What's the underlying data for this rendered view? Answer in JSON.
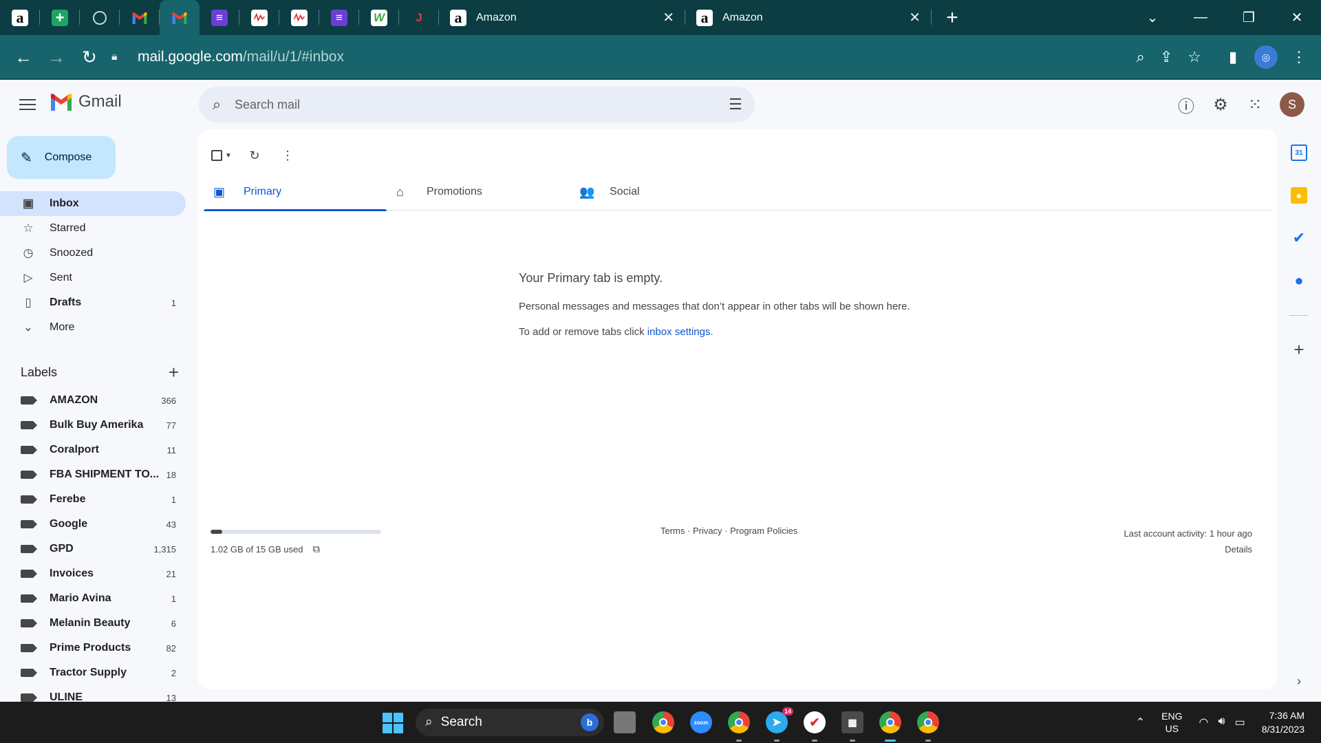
{
  "browser": {
    "pinned_tabs": [
      {
        "icon": "amazon-icon",
        "glyph": "a"
      },
      {
        "icon": "google-sheets-icon",
        "glyph": "+"
      },
      {
        "icon": "globe-icon",
        "glyph": ""
      },
      {
        "icon": "gmail-icon",
        "glyph": "M"
      },
      {
        "icon": "gmail-icon",
        "glyph": "M"
      },
      {
        "icon": "list-app-icon",
        "glyph": "≡"
      },
      {
        "icon": "chart-doc-icon",
        "glyph": "∿"
      },
      {
        "icon": "chart-doc-icon",
        "glyph": "∿"
      },
      {
        "icon": "list-app-icon",
        "glyph": "≡"
      },
      {
        "icon": "green-app-icon",
        "glyph": "W"
      },
      {
        "icon": "dark-app-icon",
        "glyph": "J"
      }
    ],
    "tabs": [
      {
        "title": "Amazon"
      },
      {
        "title": "Amazon"
      }
    ],
    "url": {
      "host": "mail.google.com",
      "path": "/mail/u/1/#inbox"
    }
  },
  "gmail": {
    "product_name": "Gmail",
    "search_placeholder": "Search mail",
    "account_initial": "S",
    "compose_label": "Compose",
    "nav": [
      {
        "label": "Inbox",
        "count": "",
        "icon": "inbox-icon",
        "glyph": "▣"
      },
      {
        "label": "Starred",
        "count": "",
        "icon": "star-icon",
        "glyph": "☆"
      },
      {
        "label": "Snoozed",
        "count": "",
        "icon": "clock-icon",
        "glyph": "◷"
      },
      {
        "label": "Sent",
        "count": "",
        "icon": "send-icon",
        "glyph": "▷"
      },
      {
        "label": "Drafts",
        "count": "1",
        "icon": "draft-icon",
        "glyph": "▯"
      },
      {
        "label": "More",
        "count": "",
        "icon": "chevron-down-icon",
        "glyph": "⌄"
      }
    ],
    "labels_title": "Labels",
    "labels": [
      {
        "name": "AMAZON",
        "count": "366"
      },
      {
        "name": "Bulk Buy Amerika",
        "count": "77"
      },
      {
        "name": "Coralport",
        "count": "11"
      },
      {
        "name": "FBA SHIPMENT TO...",
        "count": "18"
      },
      {
        "name": "Ferebe",
        "count": "1"
      },
      {
        "name": "Google",
        "count": "43"
      },
      {
        "name": "GPD",
        "count": "1,315"
      },
      {
        "name": "Invoices",
        "count": "21"
      },
      {
        "name": "Mario Avina",
        "count": "1"
      },
      {
        "name": "Melanin Beauty",
        "count": "6"
      },
      {
        "name": "Prime Products",
        "count": "82"
      },
      {
        "name": "Tractor Supply",
        "count": "2"
      },
      {
        "name": "ULINE",
        "count": "13"
      }
    ],
    "tabs": [
      {
        "label": "Primary",
        "icon": "inbox-tab-icon",
        "glyph": "▣"
      },
      {
        "label": "Promotions",
        "icon": "tag-icon",
        "glyph": "⌂"
      },
      {
        "label": "Social",
        "icon": "people-icon",
        "glyph": "👥"
      }
    ],
    "empty": {
      "title": "Your Primary tab is empty.",
      "line1": "Personal messages and messages that don’t appear in other tabs will be shown here.",
      "line2_prefix": "To add or remove tabs click ",
      "line2_link": "inbox settings",
      "line2_suffix": "."
    },
    "storage": {
      "text": "1.02 GB of 15 GB used",
      "used_fraction": 0.068
    },
    "footer_links": "Terms · Privacy · Program Policies",
    "last_activity": "Last account activity: 1 hour ago",
    "details_link": "Details"
  },
  "taskbar": {
    "search_label": "Search",
    "lang_top": "ENG",
    "lang_bottom": "US",
    "time": "7:36 AM",
    "date": "8/31/2023",
    "telegram_badge": "14"
  },
  "colors": {
    "chrome_dark": "#0b3d43",
    "chrome_toolbar": "#17646c",
    "gmail_bg": "#f6f8fc",
    "compose_bg": "#c2e7ff",
    "active_nav": "#d3e3fd",
    "accent_blue": "#0b57d0"
  }
}
